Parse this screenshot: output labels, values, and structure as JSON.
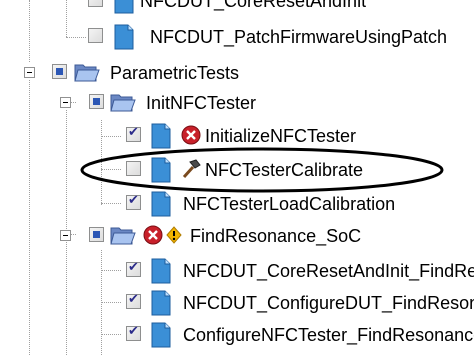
{
  "tree": {
    "items": [
      {
        "label": "NFCDUT_CoreResetAndInit",
        "check": "unchecked",
        "icon": "document-icon"
      },
      {
        "label": "NFCDUT_PatchFirmwareUsingPatch",
        "check": "unchecked",
        "icon": "document-icon"
      },
      {
        "label": "ParametricTests",
        "check": "partial",
        "icon": "folder-open-icon",
        "expanded": true
      },
      {
        "label": "InitNFCTester",
        "check": "partial",
        "icon": "folder-open-icon",
        "expanded": true
      },
      {
        "label": "InitializeNFCTester",
        "check": "checked",
        "icon": "document-icon",
        "status": "error-icon"
      },
      {
        "label": "NFCTesterCalibrate",
        "check": "unchecked",
        "icon": "document-icon",
        "status": "hammer-icon",
        "highlighted": true
      },
      {
        "label": "NFCTesterLoadCalibration",
        "check": "checked",
        "icon": "document-icon"
      },
      {
        "label": "FindResonance_SoC",
        "check": "partial",
        "icon": "folder-open-icon",
        "status": "error-icon",
        "status2": "warning-icon",
        "expanded": true
      },
      {
        "label": "NFCDUT_CoreResetAndInit_FindResonance",
        "check": "checked",
        "icon": "document-icon"
      },
      {
        "label": "NFCDUT_ConfigureDUT_FindResonance",
        "check": "checked",
        "icon": "document-icon"
      },
      {
        "label": "ConfigureNFCTester_FindResonance",
        "check": "checked",
        "icon": "document-icon"
      }
    ]
  },
  "colors": {
    "highlight_ellipse": "#000000",
    "error_red": "#c8202a",
    "warning_yellow": "#f3b400",
    "check_blue": "#2c57b5"
  }
}
